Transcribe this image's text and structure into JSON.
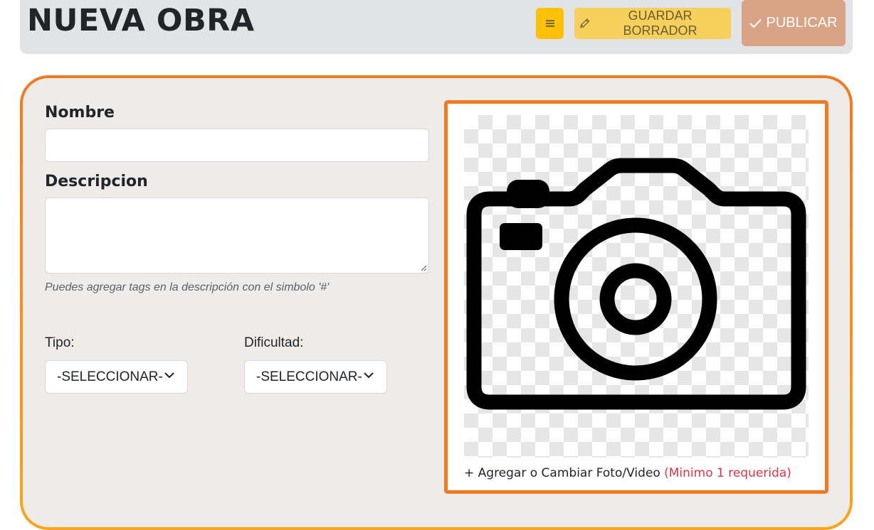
{
  "header": {
    "title": "NUEVA OBRA",
    "menu_icon": "hamburger-icon",
    "draft_label": "GUARDAR BORRADOR",
    "draft_icon": "pencil-icon",
    "publish_label": "PUBLICAR",
    "publish_icon": "check-icon"
  },
  "form": {
    "name_label": "Nombre",
    "name_value": "",
    "description_label": "Descripcion",
    "description_value": "",
    "description_help": "Puedes agregar tags en la descripción con el simbolo '#'",
    "type_label": "Tipo:",
    "type_selected": "-SELECCIONAR-",
    "difficulty_label": "Dificultad:",
    "difficulty_selected": "-SELECCIONAR-"
  },
  "media": {
    "placeholder_icon": "camera-icon",
    "add_label": "+ Agregar o Cambiar Foto/Video",
    "required_note": "(Minimo 1 requerida)"
  },
  "colors": {
    "accent": "#f07a22",
    "menu_button": "#ffc107",
    "draft_button": "#f6d05b",
    "publish_button": "#d9a486",
    "required_text": "#dc3545"
  }
}
